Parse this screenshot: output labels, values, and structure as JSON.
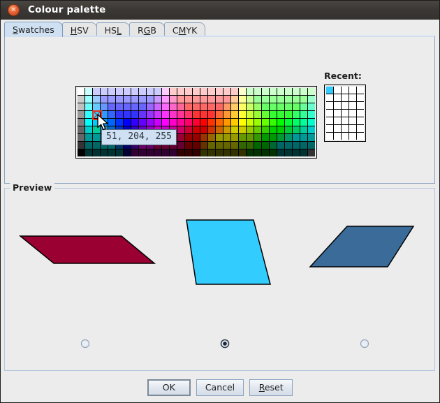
{
  "window": {
    "title": "Colour palette",
    "close_icon": "close-icon"
  },
  "tabs": [
    {
      "label": "Swatches",
      "mnemonic_index": 0,
      "selected": true
    },
    {
      "label": "HSV",
      "mnemonic_index": 0,
      "selected": false
    },
    {
      "label": "HSL",
      "mnemonic_index": 2,
      "selected": false
    },
    {
      "label": "RGB",
      "mnemonic_index": 1,
      "selected": false
    },
    {
      "label": "CMYK",
      "mnemonic_index": 1,
      "selected": false
    }
  ],
  "swatches": {
    "tooltip_text": "51, 204, 255",
    "selected_color": "#33CCFF",
    "selected_rgb": [
      51,
      204,
      255
    ],
    "columns": 31,
    "rows": 9,
    "recent": {
      "label": "Recent:",
      "columns": 5,
      "rows": 7,
      "colors": [
        "#33CCFF"
      ]
    },
    "palette": [
      [
        "#FFFFFF",
        "#CCFFFF",
        "#CCCCFF",
        "#CCCCFF",
        "#CCCCFF",
        "#CCCCFF",
        "#CCCCFF",
        "#CCCCFF",
        "#CCCCFF",
        "#CCCCFF",
        "#CCCCFF",
        "#FFCCFF",
        "#FFCCCC",
        "#FFCCCC",
        "#FFCCCC",
        "#FFCCCC",
        "#FFCCCC",
        "#FFCCCC",
        "#FFCCCC",
        "#FFCCCC",
        "#FFCCCC",
        "#FFFFCC",
        "#CCFFCC",
        "#CCFFCC",
        "#CCFFCC",
        "#CCFFCC",
        "#CCFFCC",
        "#CCFFCC",
        "#CCFFCC",
        "#CCFFCC",
        "#CCFFCC"
      ],
      [
        "#CCCCCC",
        "#99FFFF",
        "#99CCFF",
        "#9999FF",
        "#9999FF",
        "#9999FF",
        "#9999FF",
        "#9999FF",
        "#9999FF",
        "#9999FF",
        "#CC99FF",
        "#FF99FF",
        "#FF99CC",
        "#FF9999",
        "#FF9999",
        "#FF9999",
        "#FF9999",
        "#FF9999",
        "#FF9999",
        "#FF9999",
        "#FFCC99",
        "#FFFF99",
        "#CCFF99",
        "#99FF99",
        "#99FF99",
        "#99FF99",
        "#99FF99",
        "#99FF99",
        "#99FF99",
        "#99FF99",
        "#99FFCC"
      ],
      [
        "#C0C0C0",
        "#66FFFF",
        "#66CCFF",
        "#6699FF",
        "#6666FF",
        "#6666FF",
        "#6666FF",
        "#6666FF",
        "#6666FF",
        "#9966FF",
        "#CC66FF",
        "#FF66FF",
        "#FF66CC",
        "#FF6699",
        "#FF6666",
        "#FF6666",
        "#FF6666",
        "#FF6666",
        "#FF6666",
        "#FF9966",
        "#FFCC66",
        "#FFFF66",
        "#CCFF66",
        "#99FF66",
        "#66FF66",
        "#66FF66",
        "#66FF66",
        "#66FF66",
        "#66FF66",
        "#66FF99",
        "#66FFCC"
      ],
      [
        "#999999",
        "#33FFFF",
        "#33CCFF",
        "#3399FF",
        "#3366FF",
        "#3333FF",
        "#3333FF",
        "#3333FF",
        "#6633FF",
        "#9933FF",
        "#CC33FF",
        "#FF33FF",
        "#FF33CC",
        "#FF3399",
        "#FF3366",
        "#FF3333",
        "#FF3333",
        "#FF3333",
        "#FF6633",
        "#FF9933",
        "#FFCC33",
        "#FFFF33",
        "#CCFF33",
        "#99FF33",
        "#66FF33",
        "#33FF33",
        "#33FF33",
        "#33FF33",
        "#33FF66",
        "#33FF99",
        "#33FFCC"
      ],
      [
        "#808080",
        "#00FFFF",
        "#00CCFF",
        "#0099FF",
        "#0066FF",
        "#0033FF",
        "#0000FF",
        "#3300FF",
        "#6600FF",
        "#9900FF",
        "#CC00FF",
        "#FF00FF",
        "#FF00CC",
        "#FF0099",
        "#FF0066",
        "#FF0033",
        "#FF0000",
        "#FF3300",
        "#FF6600",
        "#FF9900",
        "#FFCC00",
        "#FFFF00",
        "#CCFF00",
        "#99FF00",
        "#66FF00",
        "#33FF00",
        "#00FF00",
        "#00FF33",
        "#00FF66",
        "#00FF99",
        "#00FFCC"
      ],
      [
        "#666666",
        "#00CCCC",
        "#00CC99",
        "#3399CC",
        "#0066CC",
        "#0033CC",
        "#0000CC",
        "#3300CC",
        "#6600CC",
        "#9900CC",
        "#CC00CC",
        "#CC00CC",
        "#CC0099",
        "#CC0066",
        "#CC0033",
        "#CC0000",
        "#CC0000",
        "#CC3300",
        "#CC6600",
        "#CC9900",
        "#CCCC00",
        "#CCCC00",
        "#99CC00",
        "#66CC00",
        "#33CC00",
        "#00CC00",
        "#00CC00",
        "#00CC33",
        "#00CC66",
        "#00CC99",
        "#00CCCC"
      ],
      [
        "#666666",
        "#009999",
        "#009999",
        "#339999",
        "#006699",
        "#003399",
        "#000099",
        "#330099",
        "#660099",
        "#990099",
        "#990099",
        "#990066",
        "#990066",
        "#990033",
        "#990000",
        "#990000",
        "#993300",
        "#996600",
        "#999900",
        "#999900",
        "#999900",
        "#669900",
        "#669900",
        "#339900",
        "#009900",
        "#009900",
        "#009933",
        "#009966",
        "#009999",
        "#009999",
        "#009999"
      ],
      [
        "#333333",
        "#006666",
        "#006666",
        "#006666",
        "#006666",
        "#003366",
        "#000066",
        "#330066",
        "#660066",
        "#660066",
        "#660033",
        "#660033",
        "#660033",
        "#660033",
        "#660000",
        "#660000",
        "#663300",
        "#666600",
        "#666600",
        "#666600",
        "#666600",
        "#336600",
        "#336600",
        "#006600",
        "#006600",
        "#006633",
        "#006666",
        "#006666",
        "#006666",
        "#006666",
        "#006666"
      ],
      [
        "#000000",
        "#003333",
        "#003333",
        "#003333",
        "#003333",
        "#003333",
        "#000033",
        "#330033",
        "#330033",
        "#330033",
        "#330033",
        "#330033",
        "#330033",
        "#330000",
        "#330000",
        "#330000",
        "#333300",
        "#333300",
        "#333300",
        "#333300",
        "#333300",
        "#333300",
        "#003300",
        "#003300",
        "#003300",
        "#003300",
        "#003333",
        "#003333",
        "#003333",
        "#003333",
        "#333333"
      ]
    ]
  },
  "preview": {
    "title": "Preview",
    "shapes": [
      {
        "name": "shape-left",
        "fill": "#9B0033",
        "stroke": "#000000"
      },
      {
        "name": "shape-center",
        "fill": "#33CCFF",
        "stroke": "#000000"
      },
      {
        "name": "shape-right",
        "fill": "#3A6B99",
        "stroke": "#000000"
      }
    ],
    "radios": [
      {
        "name": "radio-left",
        "selected": false
      },
      {
        "name": "radio-center",
        "selected": true
      },
      {
        "name": "radio-right",
        "selected": false
      }
    ]
  },
  "buttons": [
    {
      "label": "OK",
      "mnemonic_index": -1,
      "focused": true
    },
    {
      "label": "Cancel",
      "mnemonic_index": -1,
      "focused": false
    },
    {
      "label": "Reset",
      "mnemonic_index": 0,
      "focused": false
    }
  ]
}
